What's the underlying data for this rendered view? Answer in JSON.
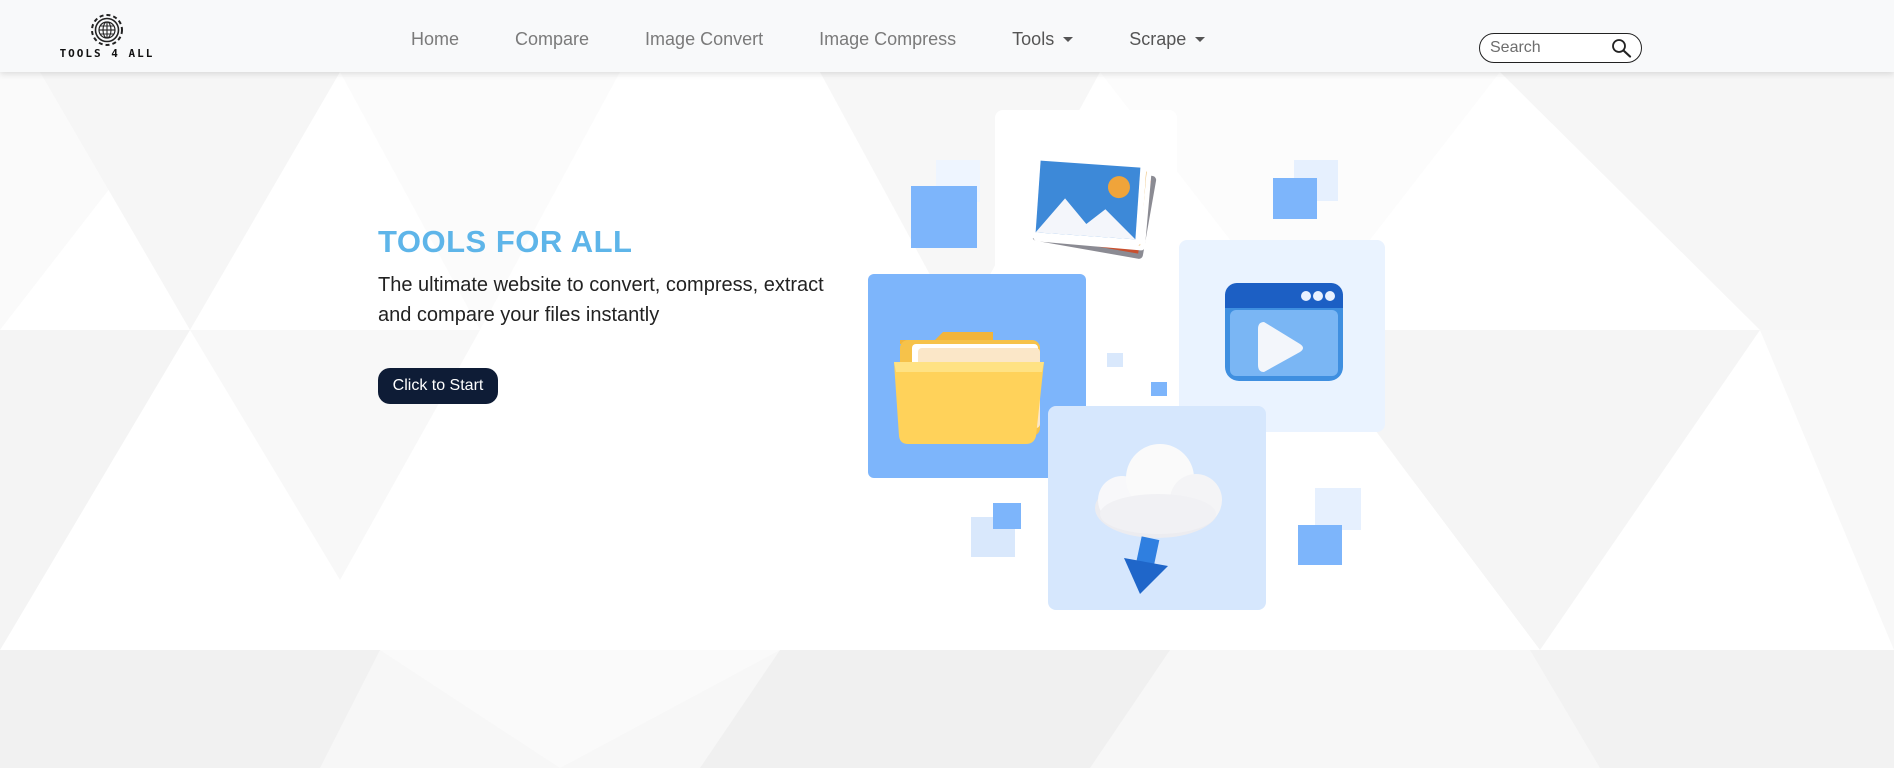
{
  "brand": {
    "logo_text": "TOOLS 4 ALL",
    "logo_icon": "gear-globe-icon"
  },
  "nav": {
    "items": [
      {
        "label": "Home",
        "dropdown": false
      },
      {
        "label": "Compare",
        "dropdown": false
      },
      {
        "label": "Image Convert",
        "dropdown": false
      },
      {
        "label": "Image Compress",
        "dropdown": false
      },
      {
        "label": "Tools",
        "dropdown": true
      },
      {
        "label": "Scrape",
        "dropdown": true
      }
    ]
  },
  "search": {
    "placeholder": "Search",
    "value": "",
    "icon": "search-icon"
  },
  "hero": {
    "title": "TOOLS FOR ALL",
    "subtitle": "The ultimate website to convert, compress, extract and compare your files instantly",
    "cta_label": "Click to Start"
  },
  "illustration": {
    "icons": [
      "photo-stack-icon",
      "folder-icon",
      "video-player-icon",
      "cloud-download-icon"
    ]
  },
  "colors": {
    "accent": "#5eb5e9",
    "button": "#0e1c36",
    "tile_blue": "#7db5fb",
    "tile_light": "#d9e8fc",
    "tile_pale": "#eef5ff"
  }
}
